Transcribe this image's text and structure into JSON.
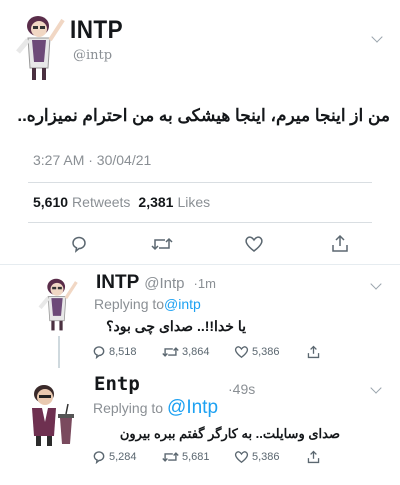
{
  "main_tweet": {
    "display_name": "INTP",
    "handle": "@intp",
    "text": "من از اینجا میرم، اینجا هیشکی به من احترام نمیزاره..",
    "timestamp": "3:27 AM · 30/04/21",
    "retweets_count": "5,610",
    "retweets_label": "Retweets",
    "likes_count": "2,381",
    "likes_label": "Likes"
  },
  "reply1": {
    "display_name": "INTP",
    "handle": "@Intp",
    "time": "·1m",
    "replying_label": "Replying to",
    "replying_handle": "@intp",
    "text": "یا خدا!!.. صدای چی بود؟",
    "replies": "8,518",
    "retweets": "3,864",
    "likes": "5,386"
  },
  "reply2": {
    "display_name": "Entp",
    "time": "·49s",
    "replying_label": "Replying to",
    "replying_handle": "@Intp",
    "text": "صدای وسایلت.. به کارگر گفتم ببره بیرون",
    "replies": "5,284",
    "retweets": "5,681",
    "likes": "5,386"
  },
  "icons": [
    "reply-icon",
    "retweet-icon",
    "like-icon",
    "share-icon",
    "chevron-down-icon"
  ],
  "colors": {
    "link": "#1da1f2",
    "muted": "#8a8f94",
    "text": "#14171a"
  }
}
